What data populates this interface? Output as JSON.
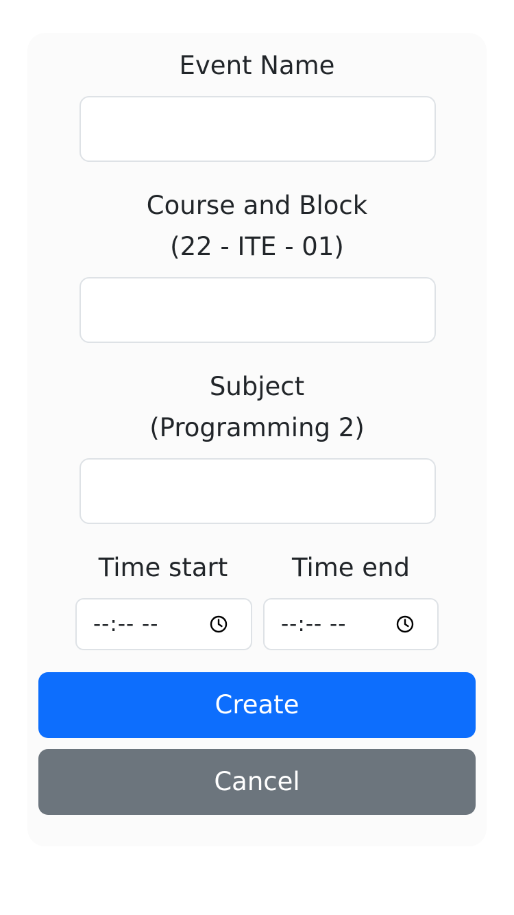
{
  "form": {
    "event_name": {
      "label": "Event Name",
      "value": "",
      "placeholder": ""
    },
    "course_block": {
      "label": "Course and Block",
      "hint": "(22 - ITE - 01)",
      "value": "",
      "placeholder": ""
    },
    "subject": {
      "label": "Subject",
      "hint": "(Programming 2)",
      "value": "",
      "placeholder": ""
    },
    "time_start": {
      "label": "Time start",
      "display": "--:-- --",
      "icon": "clock-icon"
    },
    "time_end": {
      "label": "Time end",
      "display": "--:-- --",
      "icon": "clock-icon"
    }
  },
  "buttons": {
    "create_label": "Create",
    "cancel_label": "Cancel"
  },
  "colors": {
    "primary": "#0d6efd",
    "secondary": "#6c757d",
    "card_bg": "#fbfbfb",
    "border": "#dee2e6"
  }
}
